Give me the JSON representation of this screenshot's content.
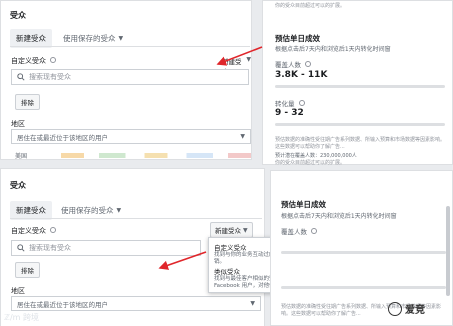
{
  "top": {
    "section_title": "受众",
    "tab_new": "新建受众",
    "tab_saved": "使用保存的受众",
    "custom_label": "自定义受众",
    "new_audience_btn": "新建受众",
    "search_placeholder": "搜索现有受众",
    "exclude_btn": "排除",
    "region_label": "地区",
    "region_value": "居住在或最近位于该地区的用户",
    "cut_label": "美国"
  },
  "bottom": {
    "section_title": "受众",
    "tab_new": "新建受众",
    "tab_saved": "使用保存的受众",
    "custom_label": "自定义受众",
    "new_audience_btn": "新建受众",
    "search_placeholder": "搜索现有受众",
    "exclude_btn": "排除",
    "region_label": "地区",
    "region_value": "居住在或最近位于该地区的用户"
  },
  "popover": {
    "item1_title": "自定义受众",
    "item1_desc": "找到与你的业务互动过的用户，对他们展开营销。",
    "item2_title": "类似受众",
    "item2_desc": "找到与最佳客户相似的受众人群来扩展 Facebook 用户，对他们展开营销。"
  },
  "right_top": {
    "top_note": "你的受众目前超过可以的扩展。",
    "title": "预估单日成效",
    "subtitle": "根据点击后7天内和浏览后1天内转化时间窗",
    "reach_label": "覆盖人数",
    "reach_value": "3.8K - 11K",
    "conv_label": "转化量",
    "conv_value": "9 - 32",
    "note1": "预估数据的准确性受往期广告系列数据、所输入预算和市场数据等因素影响。这些数据可以帮助你了解广告...",
    "note2": "预计潜在覆盖人数：230,000,000人",
    "note3": "你的受众目前超过可以的扩展。"
  },
  "right_bottom": {
    "title": "预估单日成效",
    "subtitle": "根据点击后7天内和浏览后1天内转化时间窗",
    "reach_label": "覆盖人数",
    "note1": "预估数据的准确性受往期广告系列数据、所输入预算和市场数据等因素影响。这些数据可以帮助你了解广告..."
  },
  "watermark": {
    "left": "ℤ/m 跨境",
    "right": "爱竞"
  },
  "colors": {
    "arrow": "#e0262b",
    "page_bg": "#e9ebee",
    "panel_border": "#dddfe2"
  },
  "icons": [
    "search-icon",
    "info-icon",
    "chevron-down-icon",
    "watermark-logo-icon"
  ]
}
